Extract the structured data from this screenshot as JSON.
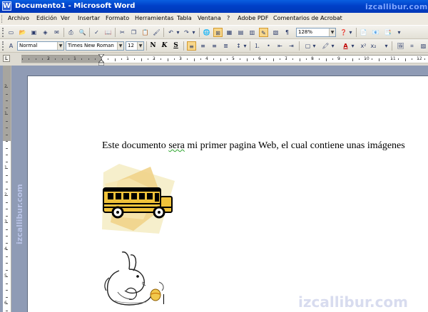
{
  "window": {
    "title": "Documento1 - Microsoft Word",
    "app_icon": "W",
    "watermark": "izcallibur.com"
  },
  "menu": {
    "items": [
      "Archivo",
      "Edición",
      "Ver",
      "Insertar",
      "Formato",
      "Herramientas",
      "Tabla",
      "Ventana",
      "?",
      "Adobe PDF",
      "Comentarios de Acrobat"
    ]
  },
  "toolbar": {
    "zoom": "128%"
  },
  "format": {
    "style": "Normal",
    "font": "Times New Roman",
    "size": "12",
    "bold": "N",
    "italic": "K",
    "underline": "S"
  },
  "document": {
    "text_before": "Este documento ",
    "text_misspelled": "sera",
    "text_after": " mi primer pagina Web, el cual contiene unas imágenes"
  },
  "watermarks": {
    "vertical": "izcallibur.com",
    "bottom": "izcallibur.com"
  },
  "ruler": {
    "h_numbers": [
      "3",
      "2",
      "1",
      "1",
      "2",
      "3",
      "4",
      "5",
      "6",
      "7",
      "8",
      "9",
      "10",
      "11",
      "12",
      "13",
      "14"
    ],
    "v_numbers": [
      "2",
      "1",
      "1",
      "2",
      "3",
      "4",
      "5",
      "6",
      "7",
      "8",
      "9",
      "10"
    ]
  }
}
